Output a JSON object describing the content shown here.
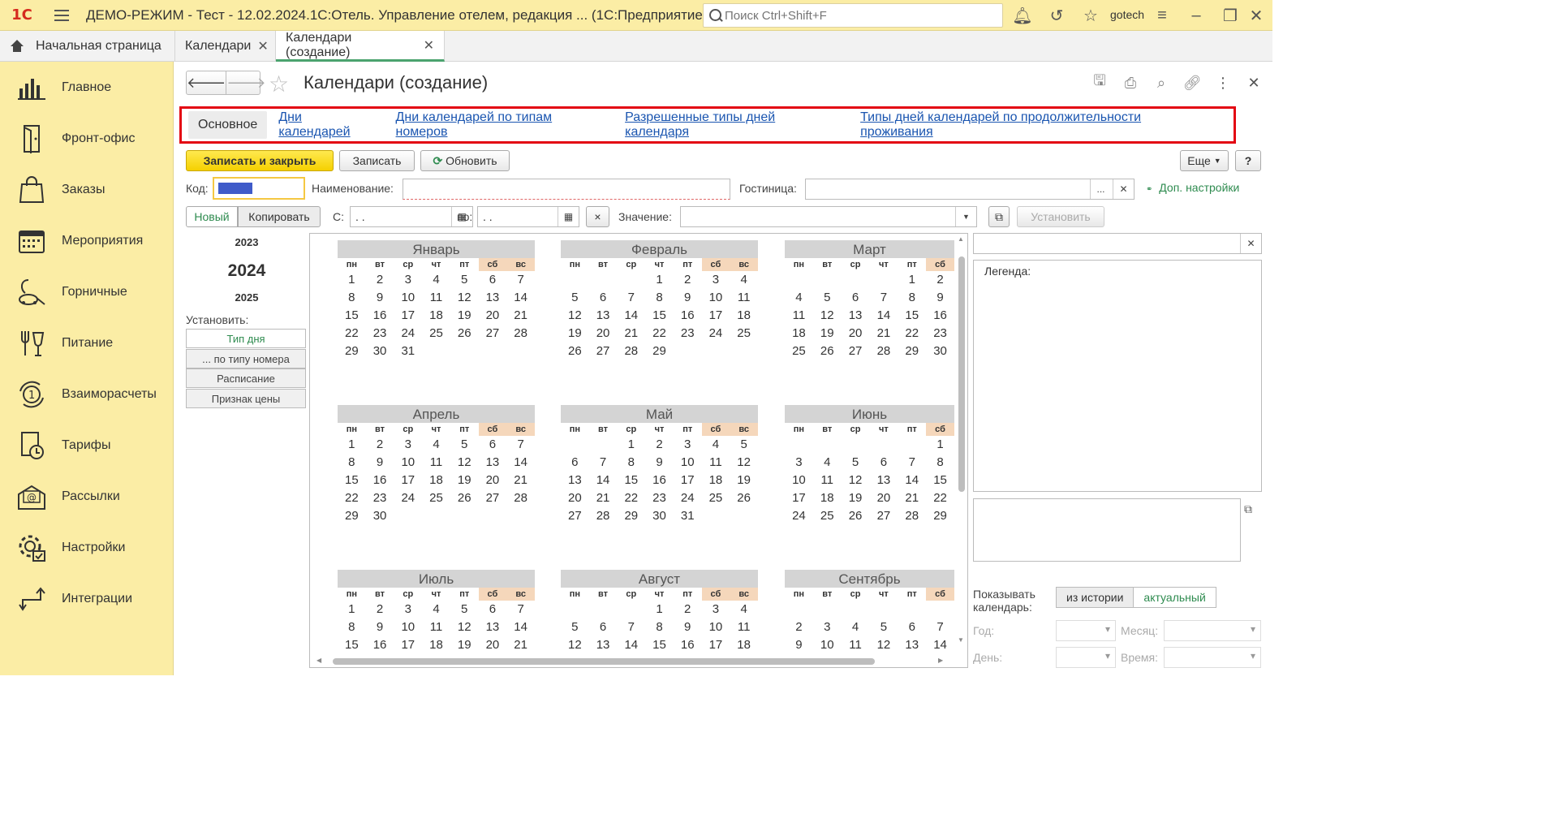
{
  "app": {
    "logo_text": "1С",
    "title": "ДЕМО-РЕЖИМ - Тест - 12.02.2024.1С:Отель. Управление отелем, редакция ...   (1С:Предприятие)",
    "search_placeholder": "Поиск Ctrl+Shift+F",
    "user": "gotech"
  },
  "tabs": [
    {
      "label": "Начальная страница"
    },
    {
      "label": "Календари"
    },
    {
      "label": "Календари (создание)"
    }
  ],
  "sidebar": [
    {
      "label": "Главное",
      "icon": "bar-chart"
    },
    {
      "label": "Фронт-офис",
      "icon": "door"
    },
    {
      "label": "Заказы",
      "icon": "shopping-bag"
    },
    {
      "label": "Мероприятия",
      "icon": "calendar"
    },
    {
      "label": "Горничные",
      "icon": "vacuum-cleaner"
    },
    {
      "label": "Питание",
      "icon": "fork-cup"
    },
    {
      "label": "Взаиморасчеты",
      "icon": "currency-cycle"
    },
    {
      "label": "Тарифы",
      "icon": "tariff-document"
    },
    {
      "label": "Рассылки",
      "icon": "mail-at"
    },
    {
      "label": "Настройки",
      "icon": "gear"
    },
    {
      "label": "Интеграции",
      "icon": "integration-arrows"
    }
  ],
  "form": {
    "title": "Календари (создание)",
    "section_tabs": [
      "Основное",
      "Дни календарей",
      "Дни календарей по типам номеров",
      "Разрешенные типы дней календаря",
      "Типы дней календарей по продолжительности проживания"
    ],
    "buttons": {
      "save_close": "Записать и закрыть",
      "save": "Записать",
      "refresh": "Обновить",
      "more": "Еще",
      "help": "?",
      "new": "Новый",
      "copy": "Копировать",
      "clear": "×",
      "set": "Установить"
    },
    "labels": {
      "code": "Код:",
      "name": "Наименование:",
      "hotel": "Гостиница:",
      "extra_settings": "Доп. настройки",
      "from": "С:",
      "to": "по:",
      "value": "Значение:",
      "set_title": "Установить:"
    },
    "fields": {
      "code": "",
      "name": "",
      "hotel": "",
      "date_from": " .  .",
      "date_to": " .  .",
      "value": ""
    },
    "years": [
      "2023",
      "2024",
      "2025"
    ],
    "set_buttons": [
      "Тип дня",
      "... по типу номера",
      "Расписание",
      "Признак цены"
    ]
  },
  "calendar": {
    "weekdays": [
      "пн",
      "вт",
      "ср",
      "чт",
      "пт",
      "сб",
      "вс"
    ],
    "months": [
      {
        "name": "Январь",
        "offset": 0,
        "days": 31,
        "weekdays_visible": 7
      },
      {
        "name": "Февраль",
        "offset": 3,
        "days": 29,
        "weekdays_visible": 7
      },
      {
        "name": "Март",
        "offset": 4,
        "days": 31,
        "weekdays_visible": 6
      },
      {
        "name": "Апрель",
        "offset": 0,
        "days": 30,
        "weekdays_visible": 7
      },
      {
        "name": "Май",
        "offset": 2,
        "days": 31,
        "weekdays_visible": 7
      },
      {
        "name": "Июнь",
        "offset": 5,
        "days": 30,
        "weekdays_visible": 6
      },
      {
        "name": "Июль",
        "offset": 0,
        "days": 21,
        "weekdays_visible": 7
      },
      {
        "name": "Август",
        "offset": 3,
        "days": 18,
        "weekdays_visible": 7
      },
      {
        "name": "Сентябрь",
        "offset": 6,
        "days": 14,
        "weekdays_visible": 6
      }
    ]
  },
  "right_panel": {
    "legend": "Легенда:",
    "show_calendar_label": "Показывать календарь:",
    "toggle_history": "из истории",
    "toggle_actual": "актуальный",
    "year_label": "Год:",
    "month_label": "Месяц:",
    "day_label": "День:",
    "time_label": "Время:"
  }
}
